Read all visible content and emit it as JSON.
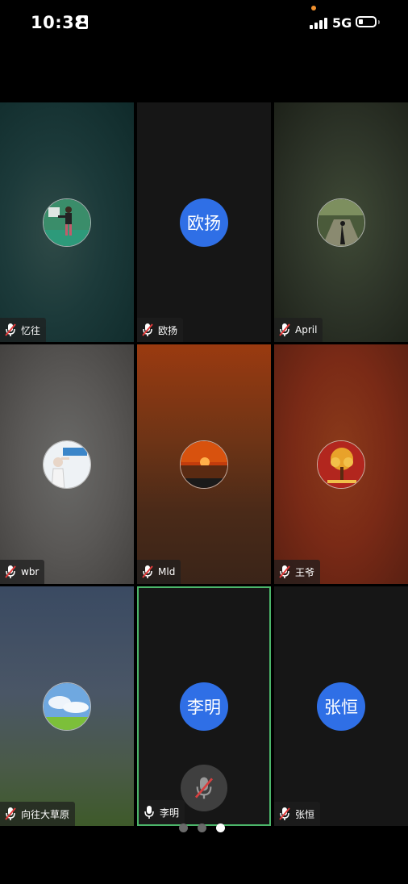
{
  "status_bar": {
    "time": "10:38",
    "network": "5G",
    "battery_level": 0.3
  },
  "participants": [
    {
      "name": "忆往",
      "avatar_type": "photo",
      "avatar_icon": "tennis-player-photo",
      "muted": true
    },
    {
      "name": "欧扬",
      "avatar_type": "text",
      "avatar_text": "欧扬",
      "muted": true
    },
    {
      "name": "April",
      "avatar_type": "photo",
      "avatar_icon": "forest-path-photo",
      "muted": true
    },
    {
      "name": "wbr",
      "avatar_type": "photo",
      "avatar_icon": "cartoon-figure-photo",
      "muted": true
    },
    {
      "name": "Mld",
      "avatar_type": "photo",
      "avatar_icon": "sunset-photo",
      "muted": true
    },
    {
      "name": "王爷",
      "avatar_type": "photo",
      "avatar_icon": "money-tree-photo",
      "muted": true
    },
    {
      "name": "向往大草原",
      "avatar_type": "photo",
      "avatar_icon": "grassland-sky-photo",
      "muted": true
    },
    {
      "name": "李明",
      "avatar_type": "text",
      "avatar_text": "李明",
      "muted": false,
      "active": true
    },
    {
      "name": "张恒",
      "avatar_type": "text",
      "avatar_text": "张恒",
      "muted": true
    }
  ],
  "avatar_color": "#2f6fe6",
  "active_border_color": "#4cb66a",
  "pager": {
    "pages": 3,
    "current": 3
  }
}
